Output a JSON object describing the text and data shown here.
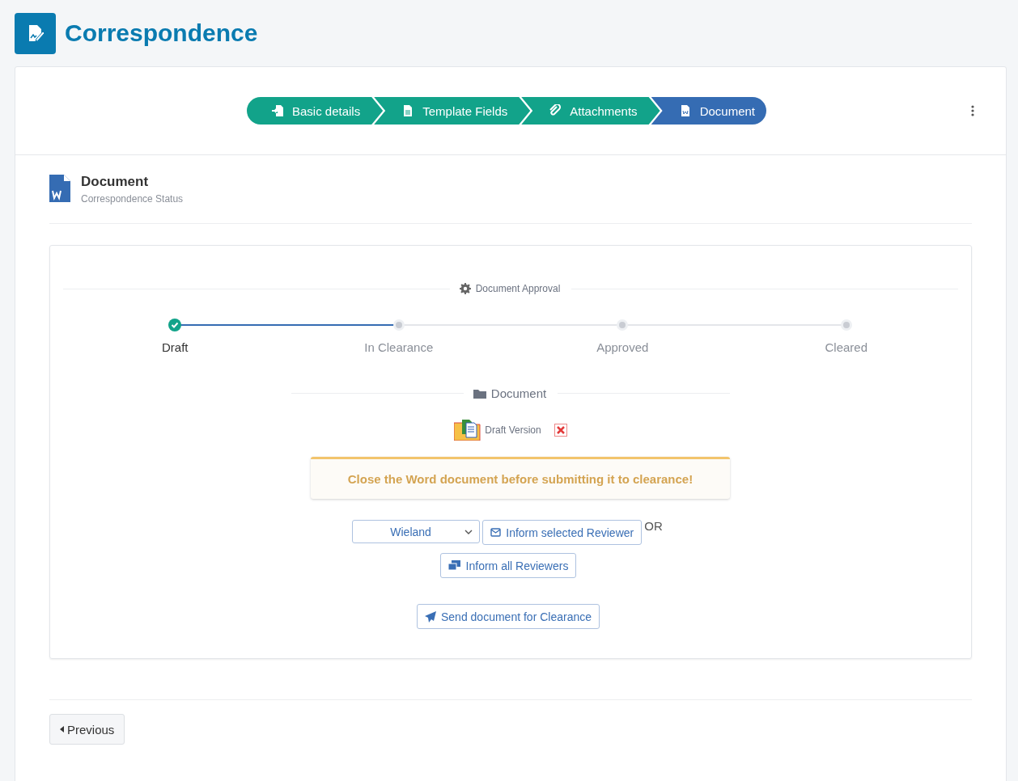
{
  "page": {
    "title": "Correspondence"
  },
  "wizard_steps": [
    {
      "label": "Basic details",
      "kind": "enter",
      "selected": false
    },
    {
      "label": "Template Fields",
      "kind": "file",
      "selected": false
    },
    {
      "label": "Attachments",
      "kind": "clip",
      "selected": false
    },
    {
      "label": "Document",
      "kind": "word",
      "selected": true
    }
  ],
  "section": {
    "title": "Document",
    "subtitle": "Correspondence Status"
  },
  "approval": {
    "title": "Document Approval",
    "steps": [
      {
        "label": "Draft",
        "completed": true
      },
      {
        "label": "In Clearance",
        "completed": false
      },
      {
        "label": "Approved",
        "completed": false
      },
      {
        "label": "Cleared",
        "completed": false
      }
    ]
  },
  "document": {
    "title": "Document",
    "file_label": "Draft Version"
  },
  "warning": "Close the Word document before submitting it to clearance!",
  "reviewer_select": {
    "value": "Wieland"
  },
  "buttons": {
    "inform_selected": "Inform selected Reviewer",
    "or": "OR",
    "inform_all": "Inform all Reviewers",
    "send": "Send document for Clearance",
    "previous": "Previous"
  }
}
